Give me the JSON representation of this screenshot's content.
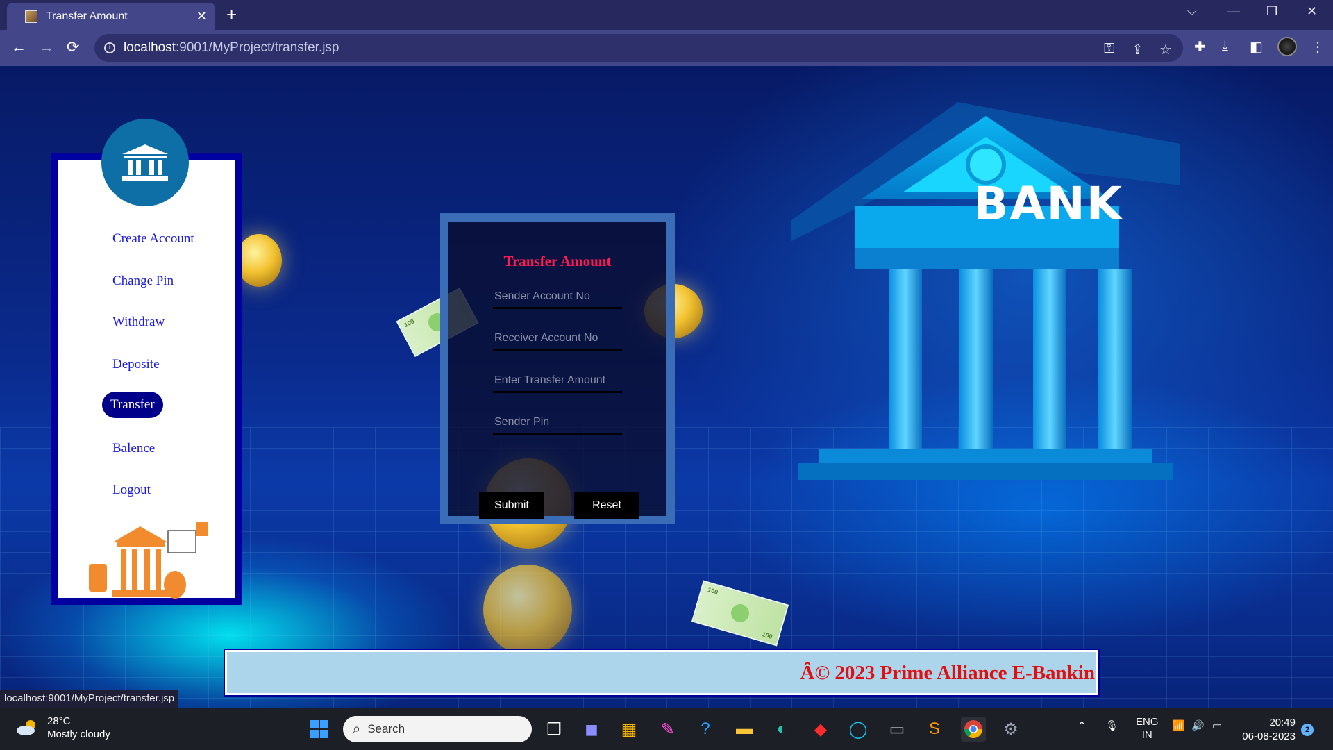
{
  "browser": {
    "tab_title": "Transfer Amount",
    "url_host": "localhost",
    "url_path": ":9001/MyProject/transfer.jsp",
    "status_url": "localhost:9001/MyProject/transfer.jsp"
  },
  "sidebar": {
    "items": [
      {
        "label": "Create Account",
        "active": false
      },
      {
        "label": "Change Pin",
        "active": false
      },
      {
        "label": "Withdraw",
        "active": false
      },
      {
        "label": "Deposite",
        "active": false
      },
      {
        "label": "Transfer",
        "active": true
      },
      {
        "label": "Balence",
        "active": false
      },
      {
        "label": "Logout",
        "active": false
      }
    ]
  },
  "form": {
    "title": "Transfer Amount",
    "fields": [
      {
        "placeholder": "Sender Account No",
        "value": ""
      },
      {
        "placeholder": "Receiver Account No",
        "value": ""
      },
      {
        "placeholder": "Enter Transfer Amount",
        "value": ""
      },
      {
        "placeholder": "Sender Pin",
        "value": ""
      }
    ],
    "submit_label": "Submit",
    "reset_label": "Reset"
  },
  "hero": {
    "bank_label": "BANK",
    "bill_denomination": "100"
  },
  "footer": {
    "text": "Â© 2023 Prime Alliance E-Bankin"
  },
  "taskbar": {
    "weather_temp": "28°C",
    "weather_desc": "Mostly cloudy",
    "search_label": "Search",
    "lang_1": "ENG",
    "lang_2": "IN",
    "time": "20:49",
    "date": "06-08-2023",
    "notification_count": "2"
  },
  "colors": {
    "accent_nav": "#00008b",
    "form_title": "#ff1a4f",
    "footer_text": "#e01010",
    "footer_bg": "#acd4ea"
  }
}
